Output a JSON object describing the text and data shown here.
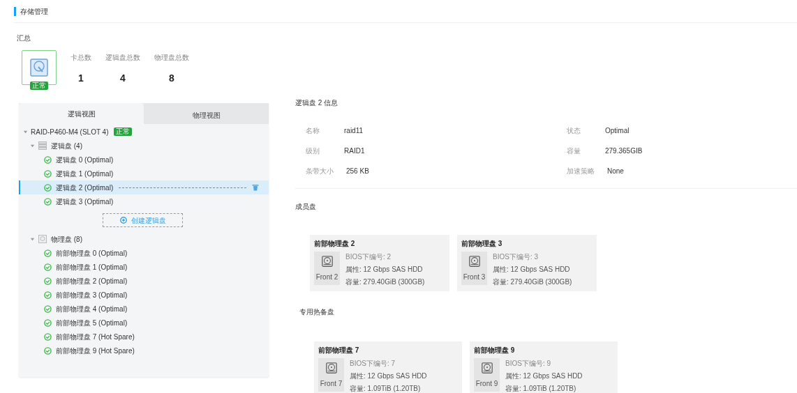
{
  "header": {
    "title": "存储管理"
  },
  "summary": {
    "title": "汇总",
    "status": "正常",
    "stats": [
      {
        "label": "卡总数",
        "value": "1"
      },
      {
        "label": "逻辑盘总数",
        "value": "4"
      },
      {
        "label": "物理盘总数",
        "value": "8"
      }
    ]
  },
  "tabs": [
    {
      "label": "逻辑视图",
      "selected": true
    },
    {
      "label": "物理视图",
      "selected": false
    }
  ],
  "tree": {
    "label": "RAID-P460-M4 (SLOT 4)",
    "status": "正常",
    "expanded": true,
    "groups": [
      {
        "kind": "logical",
        "label": "逻辑盘 (4)",
        "expanded": true,
        "create_button": "创建逻辑盘",
        "children": [
          {
            "label": "逻辑盘 0 (Optimal)",
            "selected": false
          },
          {
            "label": "逻辑盘 1 (Optimal)",
            "selected": false
          },
          {
            "label": "逻辑盘 2 (Optimal)",
            "selected": true
          },
          {
            "label": "逻辑盘 3 (Optimal)",
            "selected": false
          }
        ]
      },
      {
        "kind": "physical",
        "label": "物理盘 (8)",
        "expanded": true,
        "children": [
          {
            "label": "前部物理盘 0 (Optimal)",
            "selected": false
          },
          {
            "label": "前部物理盘 1 (Optimal)",
            "selected": false
          },
          {
            "label": "前部物理盘 2 (Optimal)",
            "selected": false
          },
          {
            "label": "前部物理盘 3 (Optimal)",
            "selected": false
          },
          {
            "label": "前部物理盘 4 (Optimal)",
            "selected": false
          },
          {
            "label": "前部物理盘 5 (Optimal)",
            "selected": false
          },
          {
            "label": "前部物理盘 7 (Hot Spare)",
            "selected": false
          },
          {
            "label": "前部物理盘 9 (Hot Spare)",
            "selected": false
          }
        ]
      }
    ]
  },
  "details": {
    "title": "逻辑盘 2 信息",
    "rows": [
      {
        "left": {
          "label": "名称",
          "value": "raid11"
        },
        "right": {
          "label": "状态",
          "value": "Optimal"
        }
      },
      {
        "left": {
          "label": "级别",
          "value": "RAID1"
        },
        "right": {
          "label": "容量",
          "value": "279.365GIB"
        }
      },
      {
        "left": {
          "label": "条带大小",
          "value": "256 KB"
        },
        "right": {
          "label": "加速策略",
          "value": "None"
        }
      }
    ]
  },
  "disk_sections": [
    {
      "title": "成员盘",
      "disks": [
        {
          "title": "前部物理盘 2",
          "slot": "Front 2",
          "bios": "BIOS下编号: 2",
          "attr": "属性: 12 Gbps SAS HDD",
          "capacity": "容量: 279.40GiB (300GB)"
        },
        {
          "title": "前部物理盘 3",
          "slot": "Front 3",
          "bios": "BIOS下编号: 3",
          "attr": "属性: 12 Gbps SAS HDD",
          "capacity": "容量: 279.40GiB (300GB)"
        }
      ]
    },
    {
      "title": "专用热备盘",
      "disks": [
        {
          "title": "前部物理盘 7",
          "slot": "Front 7",
          "bios": "BIOS下编号: 7",
          "attr": "属性: 12 Gbps SAS HDD",
          "capacity": "容量: 1.09TiB (1.20TB)"
        },
        {
          "title": "前部物理盘 9",
          "slot": "Front 9",
          "bios": "BIOS下编号: 9",
          "attr": "属性: 12 Gbps SAS HDD",
          "capacity": "容量: 1.09TiB (1.20TB)"
        }
      ]
    }
  ]
}
